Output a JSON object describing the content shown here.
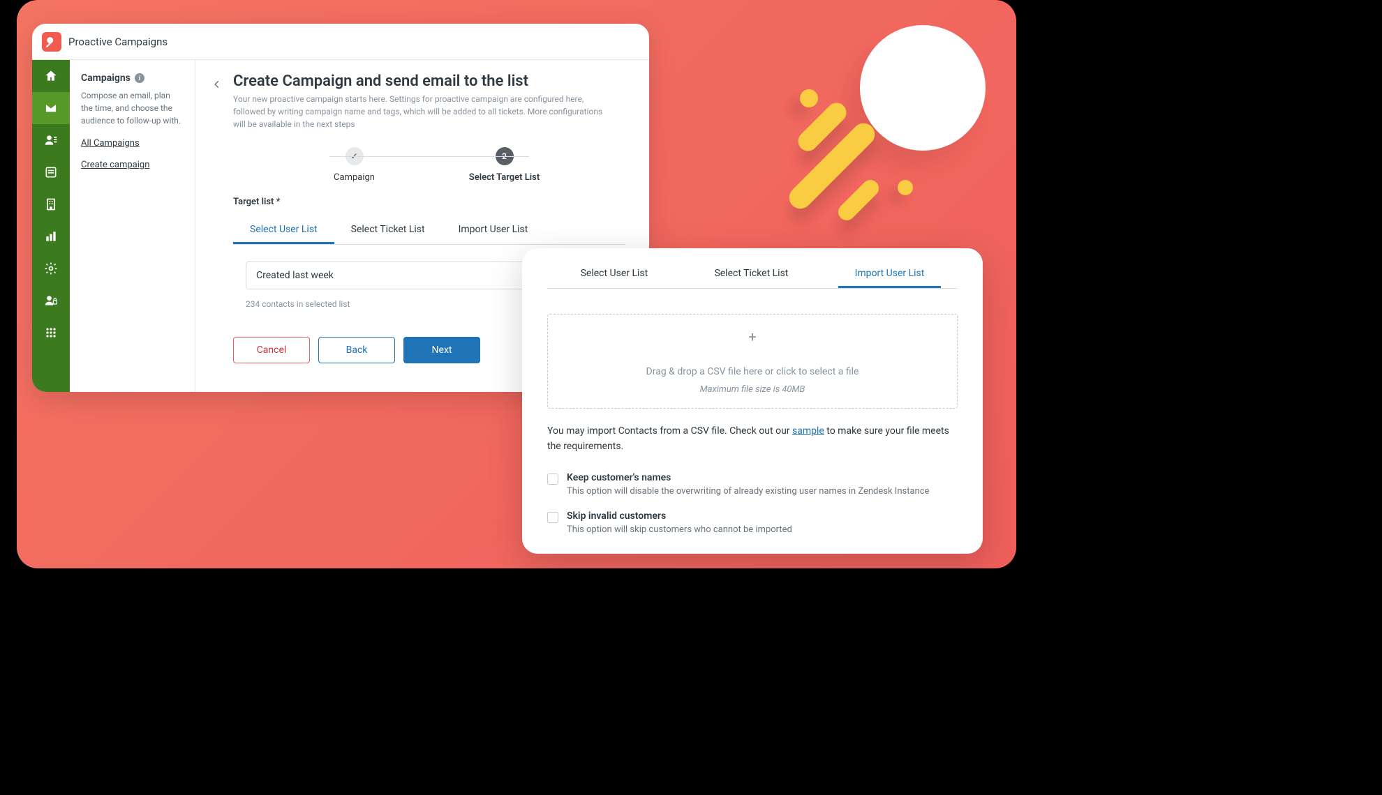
{
  "app": {
    "title": "Proactive Campaigns"
  },
  "sidebar": {
    "heading": "Campaigns",
    "description": "Compose an email, plan the time, and choose the audience to follow-up with.",
    "links": {
      "all": "All Campaigns",
      "create": "Create campaign"
    }
  },
  "rail_icons": [
    "home",
    "mail",
    "users",
    "text",
    "building",
    "bars",
    "gear",
    "lock",
    "grid"
  ],
  "page": {
    "title": "Create Campaign and send email to the list",
    "description": "Your new proactive campaign starts here. Settings for proactive campaign are configured here, followed by writing campaign name and tags, which will be added to all tickets. More configurations will be available in the next steps"
  },
  "stepper": {
    "step1": {
      "label": "Campaign",
      "state": "done",
      "symbol": "✓"
    },
    "step2": {
      "label": "Select Target List",
      "state": "active",
      "symbol": "2"
    }
  },
  "target": {
    "label": "Target list *",
    "tabs": {
      "userlist": "Select User List",
      "ticketlist": "Select Ticket List",
      "import": "Import User List"
    },
    "selected_value": "Created last week",
    "contacts_note": "234 contacts in selected list"
  },
  "buttons": {
    "cancel": "Cancel",
    "back": "Back",
    "next": "Next"
  },
  "popover": {
    "tabs": {
      "userlist": "Select User List",
      "ticketlist": "Select Ticket List",
      "import": "Import User List"
    },
    "dropzone": {
      "main": "Drag & drop a CSV file here or click to select a file",
      "sub": "Maximum file size is 40MB"
    },
    "note_pre": "You may import Contacts from a CSV file. Check out our ",
    "note_link": "sample",
    "note_post": " to make sure your file meets the requirements.",
    "opt1": {
      "title": "Keep customer's names",
      "desc": "This option will disable the overwriting of already existing user names in Zendesk Instance"
    },
    "opt2": {
      "title": "Skip invalid customers",
      "desc": "This option will skip customers who cannot be imported"
    }
  }
}
